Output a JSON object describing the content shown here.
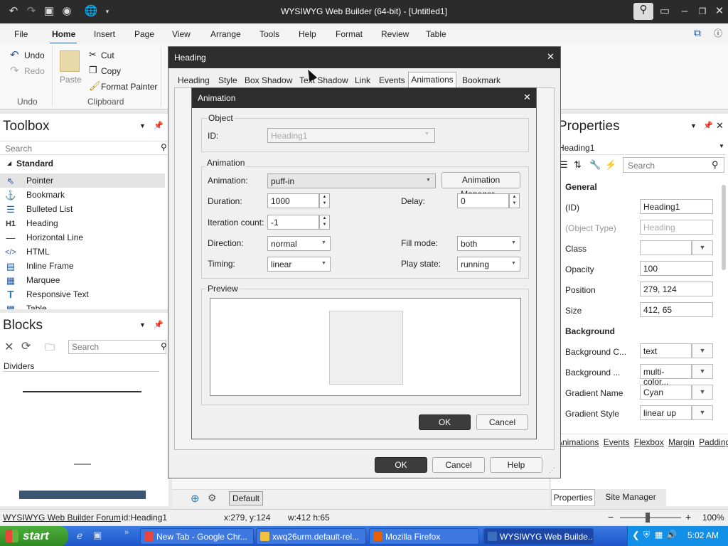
{
  "window": {
    "title": "WYSIWYG Web Builder (64-bit) - [Untitled1]"
  },
  "menubar": {
    "items": [
      "File",
      "Home",
      "Insert",
      "Page",
      "View",
      "Arrange",
      "Tools",
      "Help",
      "Format",
      "Review",
      "Table"
    ],
    "active": "Home"
  },
  "ribbon": {
    "undo": "Undo",
    "redo": "Redo",
    "undo_group": "Undo",
    "paste": "Paste",
    "cut": "Cut",
    "copy": "Copy",
    "format_painter": "Format Painter",
    "clipboard_group": "Clipboard"
  },
  "toolbox": {
    "title": "Toolbox",
    "search_placeholder": "Search",
    "category": "Standard",
    "items": [
      {
        "label": "Pointer",
        "icon": "pointer-icon"
      },
      {
        "label": "Bookmark",
        "icon": "anchor-icon"
      },
      {
        "label": "Bulleted List",
        "icon": "list-icon"
      },
      {
        "label": "Heading",
        "icon": "heading-icon"
      },
      {
        "label": "Horizontal Line",
        "icon": "line-icon"
      },
      {
        "label": "HTML",
        "icon": "code-icon"
      },
      {
        "label": "Inline Frame",
        "icon": "frame-icon"
      },
      {
        "label": "Marquee",
        "icon": "marquee-icon"
      },
      {
        "label": "Responsive Text",
        "icon": "text-icon"
      },
      {
        "label": "Table",
        "icon": "table-icon"
      }
    ]
  },
  "blocks": {
    "title": "Blocks",
    "search_placeholder": "Search",
    "category": "Dividers"
  },
  "properties": {
    "title": "Properties",
    "object": "Heading1",
    "search_placeholder": "Search",
    "general_header": "General",
    "rows": [
      {
        "label": "(ID)",
        "value": "Heading1"
      },
      {
        "label": "(Object Type)",
        "value": "Heading"
      },
      {
        "label": "Class",
        "value": ""
      },
      {
        "label": "Opacity",
        "value": "100"
      },
      {
        "label": "Position",
        "value": "279, 124"
      },
      {
        "label": "Size",
        "value": "412, 65"
      }
    ],
    "background_header": "Background",
    "bg_rows": [
      {
        "label": "Background C...",
        "value": "text"
      },
      {
        "label": "Background ...",
        "value": "multi-color..."
      },
      {
        "label": "Gradient Name",
        "value": "Cyan"
      },
      {
        "label": "Gradient Style",
        "value": "linear up"
      }
    ],
    "links": [
      "Animations",
      "Events",
      "Flexbox",
      "Margin",
      "Padding"
    ],
    "tabs": [
      "Properties",
      "Site Manager"
    ]
  },
  "heading_dialog": {
    "title": "Heading",
    "tabs": [
      "Heading",
      "Style",
      "Box Shadow",
      "Text Shadow",
      "Link",
      "Events",
      "Animations",
      "Bookmark"
    ],
    "active_tab": "Animations",
    "ok": "OK",
    "cancel": "Cancel",
    "help": "Help"
  },
  "animation_dialog": {
    "title": "Animation",
    "object_group": "Object",
    "id_label": "ID:",
    "id_value": "Heading1",
    "animation_group": "Animation",
    "animation_label": "Animation:",
    "animation_value": "puff-in",
    "manager_button": "Animation Manager...",
    "duration_label": "Duration:",
    "duration_value": "1000",
    "delay_label": "Delay:",
    "delay_value": "0",
    "iteration_label": "Iteration count:",
    "iteration_value": "-1",
    "direction_label": "Direction:",
    "direction_value": "normal",
    "fill_label": "Fill mode:",
    "fill_value": "both",
    "timing_label": "Timing:",
    "timing_value": "linear",
    "play_label": "Play state:",
    "play_value": "running",
    "preview_group": "Preview",
    "ok": "OK",
    "cancel": "Cancel"
  },
  "canvas": {
    "page_tab": "Default"
  },
  "statusbar": {
    "forum": "WYSIWYG Web Builder Forum",
    "object": "id:Heading1",
    "coords": "x:279, y:124",
    "size": "w:412 h:65",
    "zoom": "100%"
  },
  "taskbar": {
    "start": "start",
    "tasks": [
      {
        "label": "New Tab - Google Chr...",
        "color": "#e8453c"
      },
      {
        "label": "xwq26urm.default-rel...",
        "color": "#f0c040"
      },
      {
        "label": "Mozilla Firefox",
        "color": "#e66000"
      },
      {
        "label": "WYSIWYG Web Builde...",
        "color": "#3a6fc0"
      }
    ],
    "clock": "5:02 AM"
  }
}
